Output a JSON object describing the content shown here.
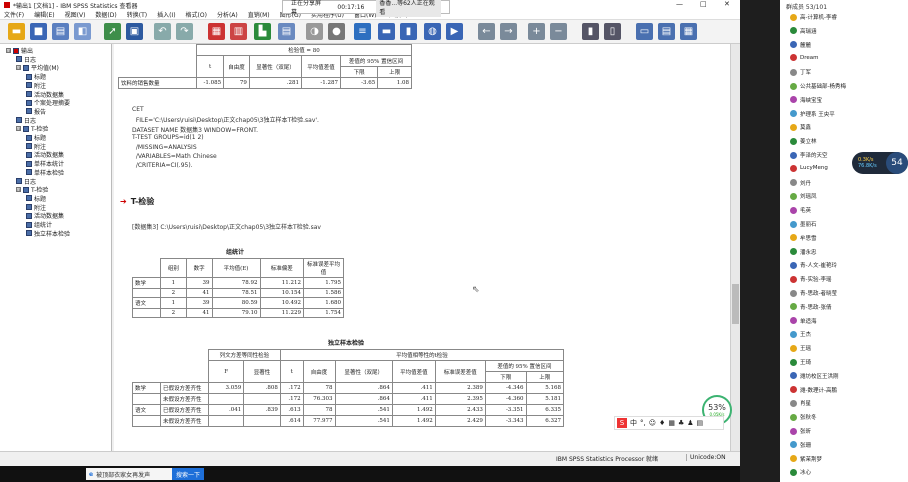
{
  "window": {
    "title": "*输出1 [文档1] - IBM SPSS Statistics 查看器",
    "minimize": "—",
    "maximize": "□",
    "close": "✕"
  },
  "share_bar": {
    "status": "正在分享屏幕",
    "time": "00:17:16",
    "viewers": "香香...等62人正在观看"
  },
  "menu": [
    "文件(F)",
    "编辑(E)",
    "视图(V)",
    "数据(D)",
    "转换(T)",
    "插入(I)",
    "格式(O)",
    "分析(A)",
    "直销(M)",
    "图形(G)",
    "实用程序(U)",
    "窗口(W)",
    "帮助(H)"
  ],
  "nav_tree": [
    {
      "label": "输出",
      "level": 0,
      "expand": "⊟"
    },
    {
      "label": "日志",
      "level": 1
    },
    {
      "label": "平均值(M)",
      "level": 1,
      "expand": "⊟"
    },
    {
      "label": "标题",
      "level": 2
    },
    {
      "label": "附注",
      "level": 2
    },
    {
      "label": "活动数据集",
      "level": 2
    },
    {
      "label": "个案处理摘要",
      "level": 2
    },
    {
      "label": "报告",
      "level": 2
    },
    {
      "label": "日志",
      "level": 1
    },
    {
      "label": "T-检验",
      "level": 1,
      "expand": "⊟"
    },
    {
      "label": "标题",
      "level": 2
    },
    {
      "label": "附注",
      "level": 2
    },
    {
      "label": "活动数据集",
      "level": 2
    },
    {
      "label": "单样本统计",
      "level": 2
    },
    {
      "label": "单样本检验",
      "level": 2
    },
    {
      "label": "日志",
      "level": 1
    },
    {
      "label": "T-检验",
      "level": 1,
      "expand": "⊟"
    },
    {
      "label": "标题",
      "level": 2
    },
    {
      "label": "附注",
      "level": 2
    },
    {
      "label": "活动数据集",
      "level": 2
    },
    {
      "label": "组统计",
      "level": 2
    },
    {
      "label": "独立样本检验",
      "level": 2
    }
  ],
  "top_table": {
    "test_value_header": "检验值 = 80",
    "headers": [
      "t",
      "自由度",
      "显著性（双尾）",
      "平均值差值",
      "下限",
      "上限"
    ],
    "ci_header": "差值的 95% 置信区间",
    "row_label": "饮料的销售数量",
    "row": [
      "-1.085",
      "79",
      ".281",
      "-1.287",
      "-3.65",
      "1.08"
    ]
  },
  "syntax": [
    "CET",
    "  FILE='C:\\Users\\ruisi\\Desktop\\正文chap05\\3独立样本T检验.sav'.",
    "DATASET NAME 数据集3 WINDOW=FRONT.",
    "T-TEST GROUPS=id(1 2)",
    "  /MISSING=ANALYSIS",
    "  /VARIABLES=Math Chinese",
    "  /CRITERIA=CI(.95)."
  ],
  "section_title": "T-检验",
  "dataset_line": "[数据集3] C:\\Users\\ruisi\\Desktop\\正文chap05\\3独立样本T检验.sav",
  "group_stats": {
    "title": "组统计",
    "headers": [
      "组别",
      "数字",
      "平均值(E)",
      "标准偏差",
      "标准误差平均值"
    ],
    "rows": [
      {
        "var": "数学",
        "group": "1",
        "n": "39",
        "mean": "78.92",
        "sd": "11.212",
        "se": "1.795"
      },
      {
        "var": "",
        "group": "2",
        "n": "41",
        "mean": "78.51",
        "sd": "10.154",
        "se": "1.586"
      },
      {
        "var": "语文",
        "group": "1",
        "n": "39",
        "mean": "80.59",
        "sd": "10.492",
        "se": "1.680"
      },
      {
        "var": "",
        "group": "2",
        "n": "41",
        "mean": "79.10",
        "sd": "11.229",
        "se": "1.754"
      }
    ]
  },
  "indep_test": {
    "title": "独立样本检验",
    "levene_header": "列文方差等同性检验",
    "ttest_header": "平均值相等性的t检验",
    "ci_header": "差值的 95% 置信区间",
    "headers": [
      "F",
      "显著性",
      "t",
      "自由度",
      "显著性（双尾）",
      "平均值差值",
      "标准误差差值",
      "下限",
      "上限"
    ],
    "rows": [
      {
        "var": "数学",
        "assume": "已假设方差齐性",
        "cells": [
          "3.059",
          ".808",
          ".172",
          "78",
          ".864",
          ".411",
          "2.389",
          "-4.346",
          "5.168"
        ]
      },
      {
        "var": "",
        "assume": "未假设方差齐性",
        "cells": [
          "",
          "",
          ".172",
          "76.303",
          ".864",
          ".411",
          "2.395",
          "-4.360",
          "5.181"
        ]
      },
      {
        "var": "语文",
        "assume": "已假设方差齐性",
        "cells": [
          ".041",
          ".839",
          ".613",
          "78",
          ".541",
          "1.492",
          "2.433",
          "-3.351",
          "6.335"
        ]
      },
      {
        "var": "",
        "assume": "未假设方差齐性",
        "cells": [
          "",
          "",
          ".614",
          "77.977",
          ".541",
          "1.492",
          "2.429",
          "-3.343",
          "6.327"
        ]
      }
    ]
  },
  "status": {
    "processor": "IBM SPSS Statistics Processor 就绪",
    "unicode": "Unicode:ON"
  },
  "taskbar": {
    "search_text": "被顶部衣家女再发声",
    "search_button": "搜索一下"
  },
  "badge": {
    "percent": "53%",
    "speed": "0.05K/s"
  },
  "ime_label": "中",
  "net_widget": {
    "up": "0.3K/s",
    "down": "76.8K/s",
    "value": "54"
  },
  "right_panel": {
    "header": "群成员 53/101",
    "members": [
      "高-计算机-李睿",
      "高瑞涵",
      "麓麓",
      "Dream",
      "丁军",
      "公共基础部-杨秀梅",
      "海峡宝宝",
      "护理系 王央平",
      "莫鑫",
      "姜立林",
      "李泽的天空",
      "LucyMeng",
      "刘丹",
      "刘瑶凤",
      "毛英",
      "墨丽石",
      "牟思雪",
      "潘永忠",
      "青-人文-崔艳玲",
      "青-实验-李瑶",
      "青-思政-者晓莹",
      "青-思政-张倩",
      "单适海",
      "王杰",
      "王瑶",
      "王琦",
      "潍坊校区王洪刚",
      "潍-数理计-高鹏",
      "肖星",
      "张秋冬",
      "张昕",
      "张珊",
      "紫茉荆梦",
      "冰心"
    ]
  }
}
